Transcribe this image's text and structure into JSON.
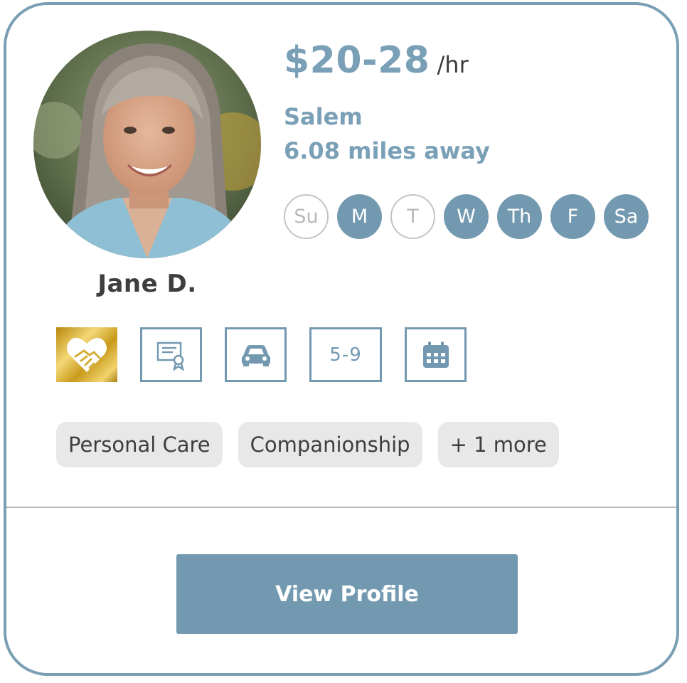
{
  "caregiver": {
    "name": "Jane D.",
    "rate": {
      "amount": "$20-28",
      "unit": "/hr"
    },
    "location": {
      "city": "Salem",
      "distance": "6.08 miles away"
    }
  },
  "availability": [
    {
      "label": "Su",
      "available": false
    },
    {
      "label": "M",
      "available": true
    },
    {
      "label": "T",
      "available": false
    },
    {
      "label": "W",
      "available": true
    },
    {
      "label": "Th",
      "available": true
    },
    {
      "label": "F",
      "available": true
    },
    {
      "label": "Sa",
      "available": true
    }
  ],
  "badges": [
    {
      "icon": "heart-handshake-icon",
      "style": "gold"
    },
    {
      "icon": "certificate-icon",
      "style": "outline"
    },
    {
      "icon": "car-icon",
      "style": "outline"
    },
    {
      "icon": "age-range",
      "text": "5-9",
      "style": "outline"
    },
    {
      "icon": "calendar-icon",
      "style": "outline"
    }
  ],
  "services": [
    "Personal Care",
    "Companionship",
    "+ 1 more"
  ],
  "actions": {
    "view_profile": "View Profile"
  },
  "colors": {
    "accent": "#7399b1",
    "accent_text": "#7aa0b7",
    "border": "#7a9fb5",
    "tag_bg": "#e8e8e8",
    "text_dark": "#3e3e3e",
    "gold": "#d4af37"
  }
}
